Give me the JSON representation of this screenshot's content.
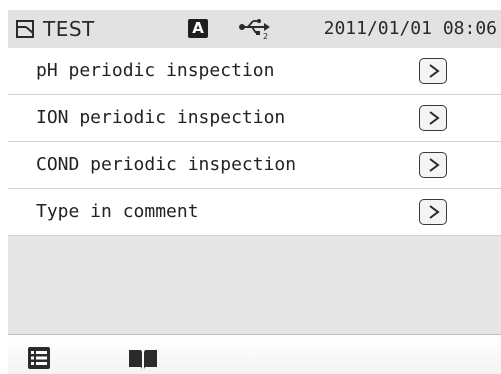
{
  "status_bar": {
    "title": "TEST",
    "mode_badge": "A",
    "file_icon": "file-icon",
    "usb_icon": "usb-icon",
    "datetime": "2011/01/01 08:06"
  },
  "menu": {
    "items": [
      {
        "label": "pH periodic inspection",
        "icon": "chevron-right-icon"
      },
      {
        "label": "ION periodic inspection",
        "icon": "chevron-right-icon"
      },
      {
        "label": "COND periodic inspection",
        "icon": "chevron-right-icon"
      },
      {
        "label": "Type in comment",
        "icon": "chevron-right-icon"
      }
    ]
  },
  "bottom_bar": {
    "left_icon": "list-icon",
    "right_icon": "book-icon"
  }
}
